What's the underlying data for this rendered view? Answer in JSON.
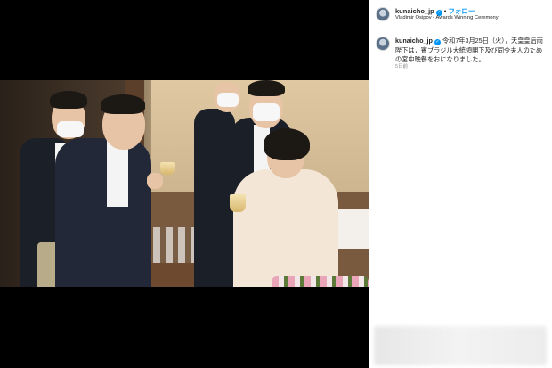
{
  "post": {
    "username": "kunaicho_jp",
    "follow_label": "フォロー",
    "separator": "•",
    "subline": "Vladimir Osipov • Awards Winning Ceremony",
    "caption_text": "令和7年3月25日（火），天皇皇后両陛下は，賓ブラジル大統領閣下及び同令夫人のための宮中晩餐をおになりました。",
    "age": "5日前"
  },
  "colors": {
    "accent": "#0095f6",
    "text": "#262626",
    "muted": "#8e8e8e"
  },
  "icons": {
    "verified": "verified-badge-icon",
    "avatar": "profile-avatar"
  }
}
